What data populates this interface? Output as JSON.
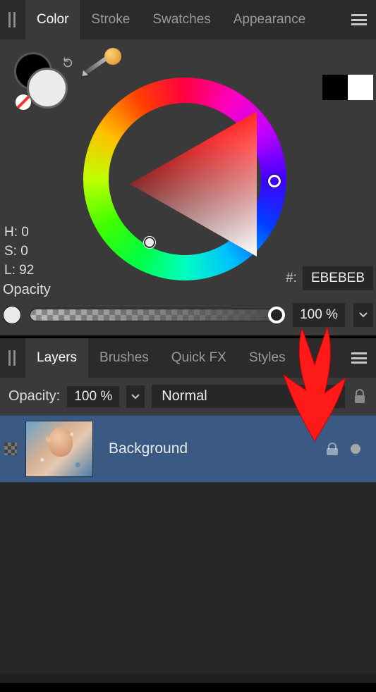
{
  "colorPanel": {
    "tabs": [
      "Color",
      "Stroke",
      "Swatches",
      "Appearance"
    ],
    "activeTab": 0,
    "hsl": {
      "hLabel": "H: 0",
      "sLabel": "S: 0",
      "lLabel": "L: 92"
    },
    "hexPrefix": "#:",
    "hex": "EBEBEB",
    "opacityLabel": "Opacity",
    "opacityValue": "100 %",
    "bwChips": {
      "black": "#000000",
      "white": "#FFFFFF"
    }
  },
  "layersPanel": {
    "tabs": [
      "Layers",
      "Brushes",
      "Quick FX",
      "Styles"
    ],
    "activeTab": 0,
    "opacityLabel": "Opacity:",
    "opacityValue": "100 %",
    "blendMode": "Normal",
    "layers": [
      {
        "name": "Background",
        "locked": true,
        "visible": true
      }
    ]
  },
  "annotation": {
    "arrowColor": "#ff1a1a"
  }
}
